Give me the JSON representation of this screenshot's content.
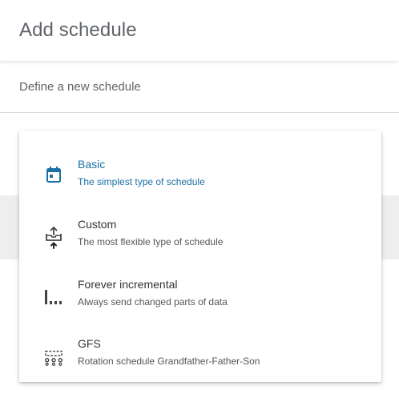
{
  "dialog": {
    "title": "Add schedule",
    "close_icon": "close-icon",
    "subtitle": "Define a new schedule"
  },
  "menu": {
    "items": [
      {
        "title": "Basic",
        "description": "The simplest type of schedule",
        "icon": "calendar-icon",
        "active": true
      },
      {
        "title": "Custom",
        "description": "The most flexible type of schedule",
        "icon": "inbox-upload-icon"
      },
      {
        "title": "Forever incremental",
        "description": "Always send changed parts of data",
        "icon": "incremental-bars-icon"
      },
      {
        "title": "GFS",
        "description": "Rotation schedule Grandfather-Father-Son",
        "icon": "gfs-hierarchy-icon"
      }
    ]
  },
  "colors": {
    "accent": "#1a6fa5",
    "icon": "#444444",
    "title_text": "#5f6368"
  }
}
